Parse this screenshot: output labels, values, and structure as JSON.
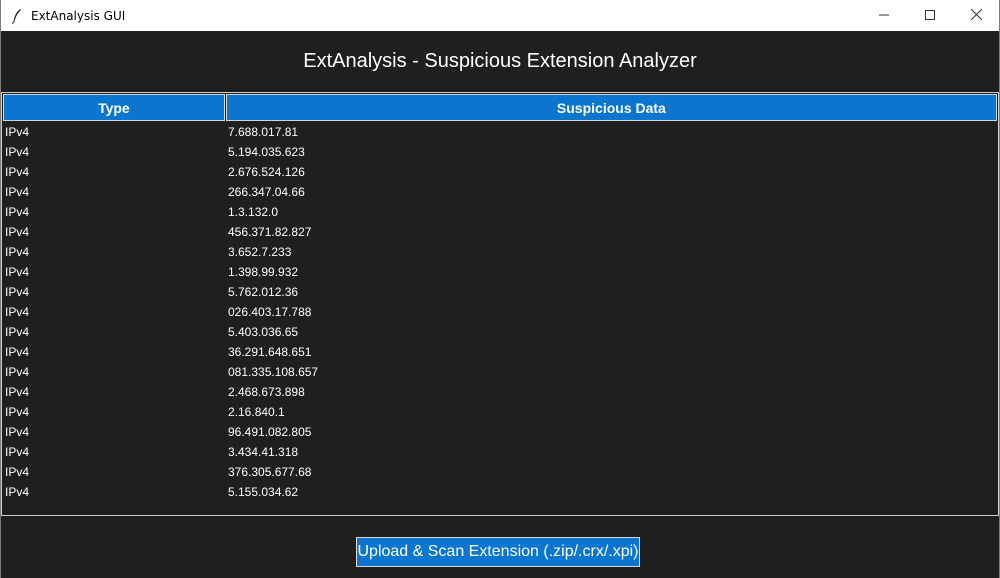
{
  "window": {
    "title": "ExtAnalysis GUI"
  },
  "header": {
    "title": "ExtAnalysis - Suspicious Extension Analyzer"
  },
  "table": {
    "columns": [
      "Type",
      "Suspicious Data"
    ],
    "rows": [
      {
        "type": "IPv4",
        "data": "7.688.017.81"
      },
      {
        "type": "IPv4",
        "data": "5.194.035.623"
      },
      {
        "type": "IPv4",
        "data": "2.676.524.126"
      },
      {
        "type": "IPv4",
        "data": "266.347.04.66"
      },
      {
        "type": "IPv4",
        "data": "1.3.132.0"
      },
      {
        "type": "IPv4",
        "data": "456.371.82.827"
      },
      {
        "type": "IPv4",
        "data": "3.652.7.233"
      },
      {
        "type": "IPv4",
        "data": "1.398.99.932"
      },
      {
        "type": "IPv4",
        "data": "5.762.012.36"
      },
      {
        "type": "IPv4",
        "data": "026.403.17.788"
      },
      {
        "type": "IPv4",
        "data": "5.403.036.65"
      },
      {
        "type": "IPv4",
        "data": "36.291.648.651"
      },
      {
        "type": "IPv4",
        "data": "081.335.108.657"
      },
      {
        "type": "IPv4",
        "data": "2.468.673.898"
      },
      {
        "type": "IPv4",
        "data": "2.16.840.1"
      },
      {
        "type": "IPv4",
        "data": "96.491.082.805"
      },
      {
        "type": "IPv4",
        "data": "3.434.41.318"
      },
      {
        "type": "IPv4",
        "data": "376.305.677.68"
      },
      {
        "type": "IPv4",
        "data": "5.155.034.62"
      }
    ]
  },
  "actions": {
    "upload_label": "Upload & Scan Extension (.zip/.crx/.xpi)"
  },
  "icons": {
    "app": "feather-icon",
    "minimize": "minimize-icon",
    "maximize": "maximize-icon",
    "close": "close-icon"
  },
  "colors": {
    "accent": "#0a76cf",
    "background": "#1f1f1f",
    "text": "#ffffff"
  }
}
